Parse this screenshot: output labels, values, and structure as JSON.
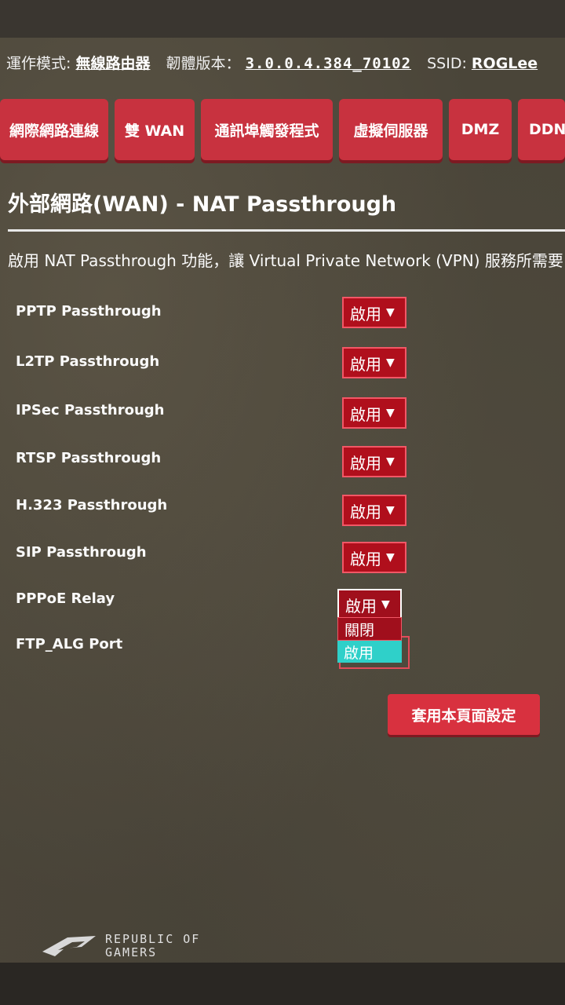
{
  "status": {
    "mode_label": "運作模式:",
    "mode_value": "無線路由器",
    "firmware_label": "韌體版本：",
    "firmware_value": "3.0.0.4.384_70102",
    "ssid_label": "SSID:",
    "ssid_value": "ROGLee"
  },
  "tabs": [
    {
      "label": "網際網路連線"
    },
    {
      "label": "雙 WAN"
    },
    {
      "label": "通訊埠觸發程式"
    },
    {
      "label": "虛擬伺服器"
    },
    {
      "label": "DMZ"
    },
    {
      "label": "DDN"
    }
  ],
  "page": {
    "title": "外部網路(WAN) - NAT Passthrough",
    "description": "啟用 NAT Passthrough 功能，讓 Virtual Private Network (VPN) 服務所需要"
  },
  "settings": [
    {
      "label": "PPTP Passthrough",
      "value": "啟用"
    },
    {
      "label": "L2TP Passthrough",
      "value": "啟用"
    },
    {
      "label": "IPSec Passthrough",
      "value": "啟用"
    },
    {
      "label": "RTSP Passthrough",
      "value": "啟用"
    },
    {
      "label": "H.323 Passthrough",
      "value": "啟用"
    },
    {
      "label": "SIP Passthrough",
      "value": "啟用"
    },
    {
      "label": "PPPoE Relay",
      "value": "啟用"
    },
    {
      "label": "FTP_ALG Port",
      "value": ""
    }
  ],
  "dropdown_options": [
    "關閉",
    "啟用"
  ],
  "apply_label": "套用本頁面設定",
  "logo": {
    "line1": "REPUBLIC OF",
    "line2": "GAMERS"
  },
  "colors": {
    "accent": "#c8323f",
    "highlight": "#2fd0c9"
  }
}
